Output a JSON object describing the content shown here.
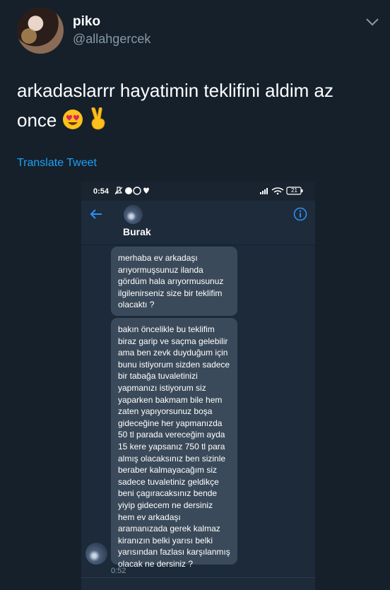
{
  "author": {
    "display_name": "piko",
    "handle": "@allahgercek"
  },
  "tweet": {
    "text": "arkadaslarrr hayatimin teklifini aldim az once",
    "emojis": [
      "smiling-face-with-heart-eyes",
      "victory-hand"
    ],
    "translate_label": "Translate Tweet"
  },
  "embedded_screenshot": {
    "status_bar": {
      "time": "0:54",
      "battery": "21"
    },
    "chat": {
      "contact_name": "Burak",
      "messages": [
        {
          "text": "merhaba ev arkadaşı arıyormuşsunuz ilanda gördüm hala arıyormusunuz ilgilenirseniz size bir teklifim olacaktı  ?"
        },
        {
          "text": "bakın öncelikle bu teklifim biraz garip ve saçma gelebilir ama ben zevk duyduğum için bunu istiyorum sizden sadece bir tabağa tuvaletinizi yapmanızı istiyorum siz yaparken bakmam bile hem zaten yapıyorsunuz boşa gideceğine her yapmanızda 50 tl parada vereceğim ayda 15 kere yapsanız 750 tl para almış olacaksınız ben sizinle beraber kalmayacağım siz sadece tuvaletiniz geldikçe beni çagıracaksınız bende yiyip gidecem ne dersiniz hem ev arkadaşı aramanızada gerek kalmaz kiranızın belki yarısı belki yarısından fazlası karşılanmış olacak ne dersiniz ?"
        }
      ],
      "message_time": "0:52"
    }
  },
  "colors": {
    "background": "#15202b",
    "accent": "#1da1f2",
    "secondary_text": "#8899a6",
    "bubble": "#3b4a5a"
  }
}
